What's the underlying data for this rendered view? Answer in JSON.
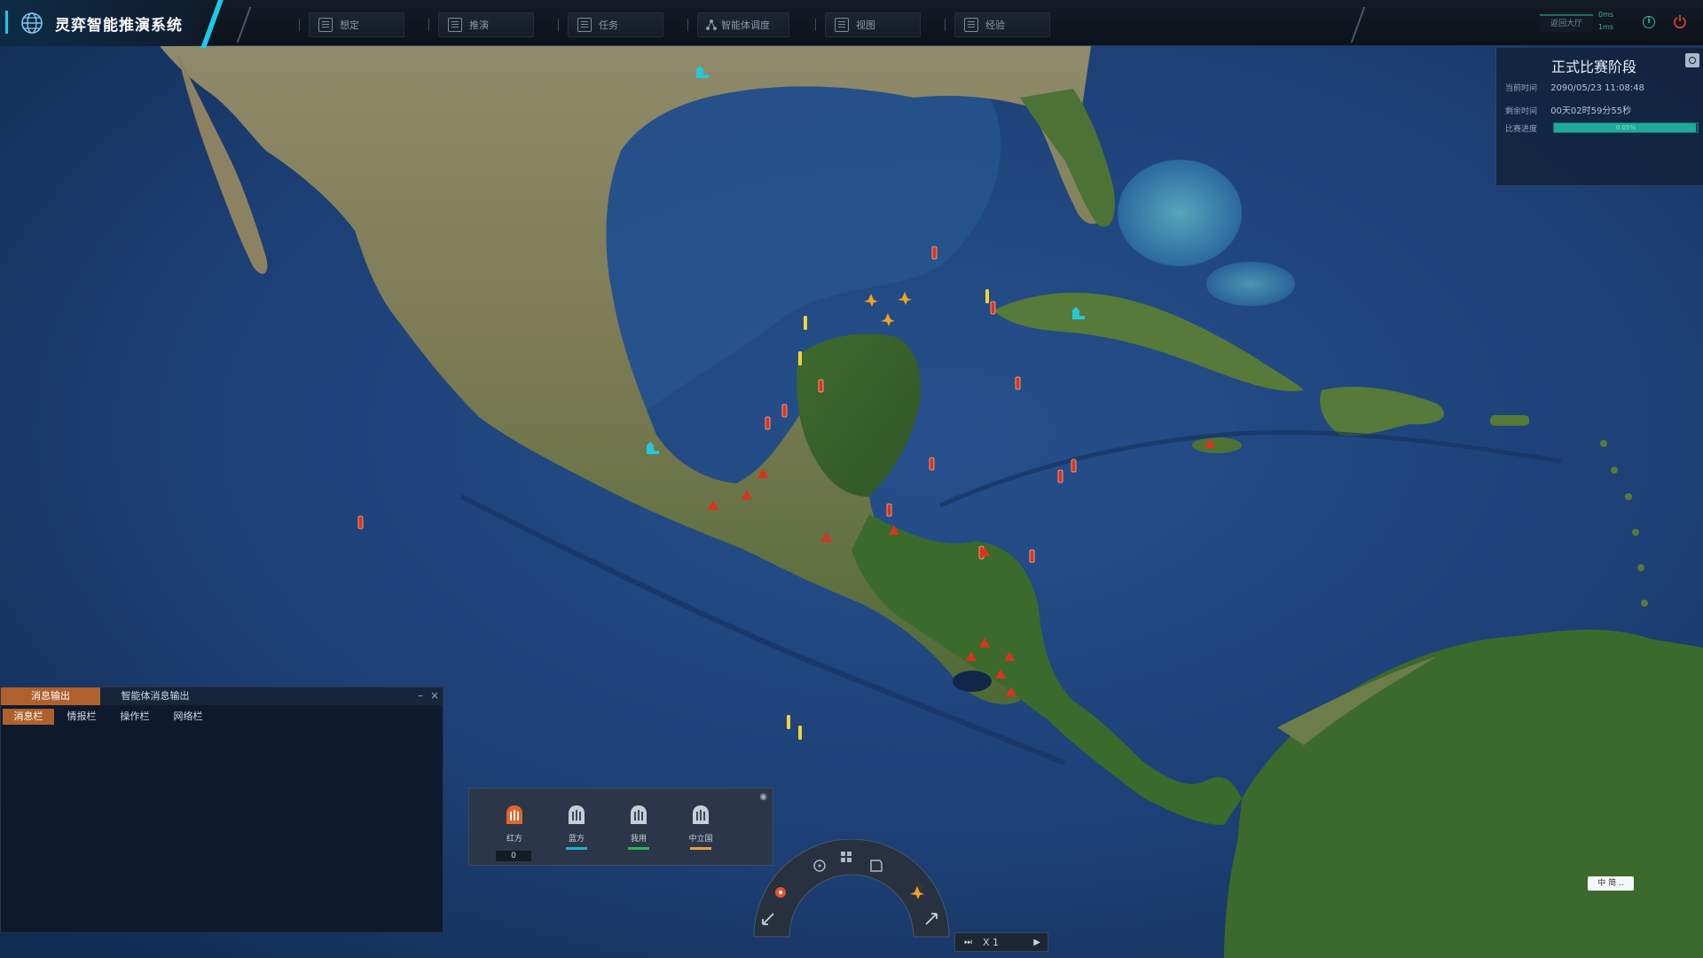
{
  "app": {
    "title": "灵弈智能推演系统"
  },
  "menu": [
    {
      "label": "想定"
    },
    {
      "label": "推演"
    },
    {
      "label": "任务"
    },
    {
      "label": "智能体调度"
    },
    {
      "label": "视图"
    },
    {
      "label": "经验"
    }
  ],
  "status": {
    "hall_label": "返回大厅",
    "ping_top": "0ms",
    "ping_bottom": "1ms",
    "info_glyph": "i"
  },
  "contest": {
    "title": "正式比赛阶段",
    "current_time_label": "当前时间",
    "current_time_value": "2090/05/23 11:08:48",
    "remaining_label": "剩余时间",
    "remaining_value": "00天02时59分55秒",
    "progress_label": "比赛进度",
    "progress_value": "0.05%",
    "progress_fraction": 0.99
  },
  "messages": {
    "tabs": [
      {
        "label": "消息输出",
        "active": true
      },
      {
        "label": "智能体消息输出",
        "active": false
      }
    ],
    "minimize": "–",
    "close": "×",
    "subtabs": [
      {
        "label": "消息栏",
        "active": true
      },
      {
        "label": "情报栏",
        "active": false
      },
      {
        "label": "操作栏",
        "active": false
      },
      {
        "label": "网络栏",
        "active": false
      }
    ]
  },
  "factions": {
    "items": [
      {
        "label": "红方",
        "color": "#e3642a"
      },
      {
        "label": "蓝方",
        "color": "#21b3c9"
      },
      {
        "label": "我用",
        "color": "#2fb55c"
      },
      {
        "label": "中立国",
        "color": "#e0a23a"
      }
    ],
    "count": "0"
  },
  "playback": {
    "speed": "X 1"
  },
  "map_label": "中 简 ..",
  "colors": {
    "accent": "#1ec9e8",
    "red_unit": "#d9341c",
    "yellow_unit": "#f2d23a",
    "orange_unit": "#f3a21f",
    "cyan_unit": "#29c6d8"
  }
}
